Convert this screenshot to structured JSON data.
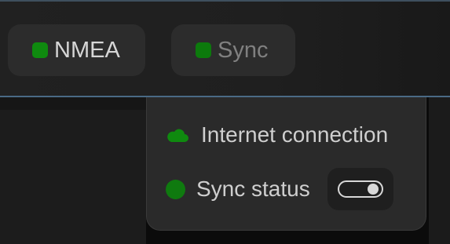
{
  "status_bar": {
    "items": [
      {
        "label": "NMEA",
        "indicator_color": "#0f8a0f",
        "state": "active"
      },
      {
        "label": "Sync",
        "indicator_color": "#0c7a0c",
        "state": "muted"
      }
    ]
  },
  "sync_popover": {
    "internet": {
      "label": "Internet connection",
      "icon": "cloud-icon",
      "icon_color": "#0f8a0f"
    },
    "sync_status": {
      "label": "Sync status",
      "indicator_color": "#0f7a0f",
      "toggle_on": true
    }
  },
  "colors": {
    "accent_border": "#4a6a85",
    "status_green": "#0f8a0f"
  }
}
